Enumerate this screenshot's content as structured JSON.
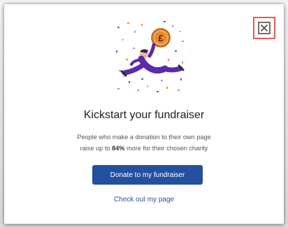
{
  "dialog": {
    "title": "Kickstart your fundraiser",
    "description_part1": "People who make a donation to their own page",
    "description_part2_prefix": "raise up to ",
    "description_highlight": "84%",
    "description_part2_suffix": " more for their chosen charity",
    "primary_button_label": "Donate to my fundraiser",
    "secondary_link_label": "Check out my page",
    "close_icon": "close-icon",
    "coin_symbol": "£"
  },
  "colors": {
    "primary": "#23509f",
    "close_border": "#e15a5a",
    "figure_purple": "#5b2aa8",
    "coin_orange": "#e88a2b"
  }
}
